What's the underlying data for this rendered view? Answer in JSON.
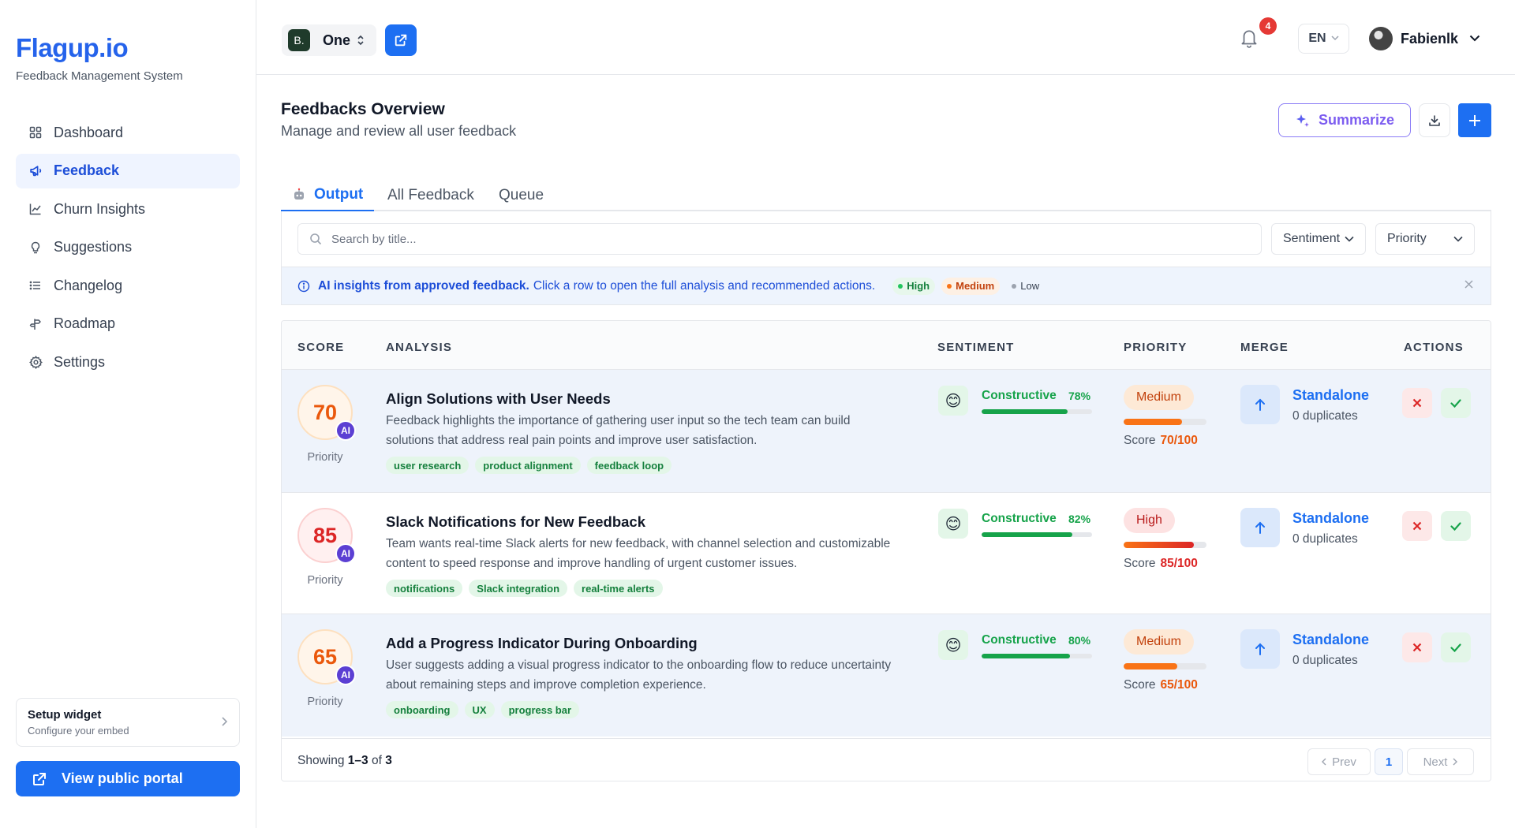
{
  "sidebar": {
    "brand": "Flagup.io",
    "subtitle": "Feedback Management System",
    "items": [
      {
        "label": "Dashboard",
        "icon": "grid-icon"
      },
      {
        "label": "Feedback",
        "icon": "megaphone-icon",
        "active": true
      },
      {
        "label": "Churn Insights",
        "icon": "chart-line-icon"
      },
      {
        "label": "Suggestions",
        "icon": "lightbulb-icon"
      },
      {
        "label": "Changelog",
        "icon": "list-icon"
      },
      {
        "label": "Roadmap",
        "icon": "signpost-icon"
      },
      {
        "label": "Settings",
        "icon": "gear-icon"
      }
    ],
    "setup": {
      "title": "Setup widget",
      "subtitle": "Configure your embed"
    },
    "portal_label": "View public portal"
  },
  "topbar": {
    "workspace_initial": "B.",
    "workspace_name": "One",
    "notification_count": "4",
    "language": "EN",
    "user_name": "Fabienlk"
  },
  "page": {
    "title": "Feedbacks Overview",
    "subtitle": "Manage and review all user feedback",
    "summarize_label": "Summarize"
  },
  "tabs": [
    {
      "label": "Output",
      "icon": "robot-icon",
      "active": true
    },
    {
      "label": "All Feedback"
    },
    {
      "label": "Queue"
    }
  ],
  "filters": {
    "search_placeholder": "Search by title...",
    "sentiment_label": "Sentiment",
    "priority_label": "Priority"
  },
  "info": {
    "strong": "AI insights from approved feedback.",
    "rest": "Click a row to open the full analysis and recommended actions.",
    "legend_high": "High",
    "legend_medium": "Medium",
    "legend_low": "Low"
  },
  "table": {
    "headers": {
      "score": "SCORE",
      "analysis": "ANALYSIS",
      "sentiment": "SENTIMENT",
      "priority": "PRIORITY",
      "merge": "MERGE",
      "actions": "ACTIONS"
    },
    "rows": [
      {
        "score": "70",
        "ai": "AI",
        "score_label": "Priority",
        "level": "medium",
        "title": "Align Solutions with User Needs",
        "description": "Feedback highlights the importance of gathering user input so the tech team can build solutions that address real pain points and improve user satisfaction.",
        "tags": [
          "user research",
          "product alignment",
          "feedback loop"
        ],
        "sentiment": "Constructive",
        "sentiment_pct": "78%",
        "sentiment_value": 78,
        "priority": "Medium",
        "priority_score_label": "Score",
        "priority_score": "70/100",
        "priority_value": 70,
        "merge": "Standalone",
        "duplicates": "0 duplicates"
      },
      {
        "score": "85",
        "ai": "AI",
        "score_label": "Priority",
        "level": "high",
        "title": "Slack Notifications for New Feedback",
        "description": "Team wants real-time Slack alerts for new feedback, with channel selection and customizable content to speed response and improve handling of urgent customer issues.",
        "tags": [
          "notifications",
          "Slack integration",
          "real-time alerts"
        ],
        "sentiment": "Constructive",
        "sentiment_pct": "82%",
        "sentiment_value": 82,
        "priority": "High",
        "priority_score_label": "Score",
        "priority_score": "85/100",
        "priority_value": 85,
        "merge": "Standalone",
        "duplicates": "0 duplicates"
      },
      {
        "score": "65",
        "ai": "AI",
        "score_label": "Priority",
        "level": "medium",
        "title": "Add a Progress Indicator During Onboarding",
        "description": "User suggests adding a visual progress indicator to the onboarding flow to reduce uncertainty about remaining steps and improve completion experience.",
        "tags": [
          "onboarding",
          "UX",
          "progress bar"
        ],
        "sentiment": "Constructive",
        "sentiment_pct": "80%",
        "sentiment_value": 80,
        "priority": "Medium",
        "priority_score_label": "Score",
        "priority_score": "65/100",
        "priority_value": 65,
        "merge": "Standalone",
        "duplicates": "0 duplicates"
      }
    ],
    "footer": {
      "showing_prefix": "Showing",
      "range": "1–3",
      "of": "of",
      "total": "3",
      "prev": "Prev",
      "page": "1",
      "next": "Next"
    }
  }
}
